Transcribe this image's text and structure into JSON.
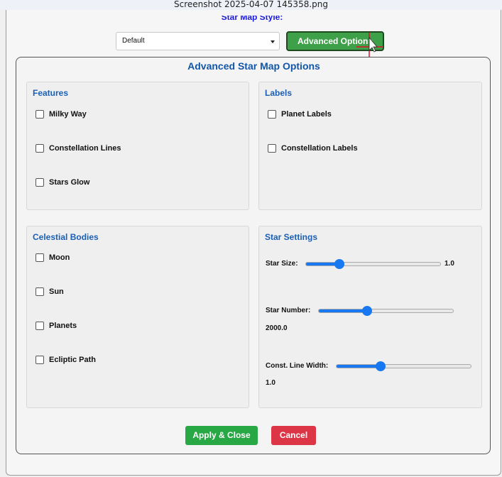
{
  "window": {
    "title": "Screenshot 2025-04-07 145358.png"
  },
  "toolbar": {
    "style_label": "Star Map Style:",
    "style_select_value": "Default",
    "advanced_button": "Advanced Options"
  },
  "modal": {
    "title": "Advanced Star Map Options",
    "features": {
      "title": "Features",
      "items": [
        {
          "label": "Milky Way",
          "checked": false
        },
        {
          "label": "Constellation Lines",
          "checked": false
        },
        {
          "label": "Stars Glow",
          "checked": false
        }
      ]
    },
    "labels": {
      "title": "Labels",
      "items": [
        {
          "label": "Planet Labels",
          "checked": false
        },
        {
          "label": "Constellation Labels",
          "checked": false
        }
      ]
    },
    "celestial": {
      "title": "Celestial Bodies",
      "items": [
        {
          "label": "Moon",
          "checked": false
        },
        {
          "label": "Sun",
          "checked": false
        },
        {
          "label": "Planets",
          "checked": false
        },
        {
          "label": "Ecliptic Path",
          "checked": false
        }
      ]
    },
    "star_settings": {
      "title": "Star Settings",
      "star_size": {
        "label": "Star Size:",
        "value": "1.0",
        "fraction": 0.25
      },
      "star_number": {
        "label": "Star Number:",
        "value": "2000.0",
        "fraction": 0.36
      },
      "line_width": {
        "label": "Const. Line Width:",
        "value": "1.0",
        "fraction": 0.33
      }
    },
    "buttons": {
      "apply": "Apply & Close",
      "cancel": "Cancel"
    }
  },
  "colors": {
    "accent": "#1778f2",
    "title_blue": "#1256a8",
    "apply_green": "#28a745",
    "cancel_red": "#dc3545",
    "advanced_green": "#3fa04a"
  }
}
